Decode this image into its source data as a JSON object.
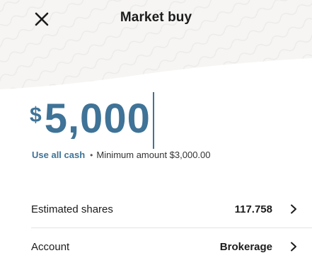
{
  "header": {
    "title": "Market buy",
    "close_icon": "close-icon"
  },
  "amount": {
    "currency_symbol": "$",
    "value": "5,000"
  },
  "helper": {
    "use_all_cash_label": "Use all cash",
    "separator": "•",
    "minimum_text": "Minimum amount $3,000.00"
  },
  "details": [
    {
      "label": "Estimated shares",
      "value": "117.758",
      "icon": "chevron-right-icon"
    },
    {
      "label": "Account",
      "value": "Brokerage",
      "icon": "chevron-right-icon"
    }
  ],
  "colors": {
    "accent": "#3f7397",
    "text": "#1c1c1c",
    "header_background": "#f6f5f4"
  }
}
